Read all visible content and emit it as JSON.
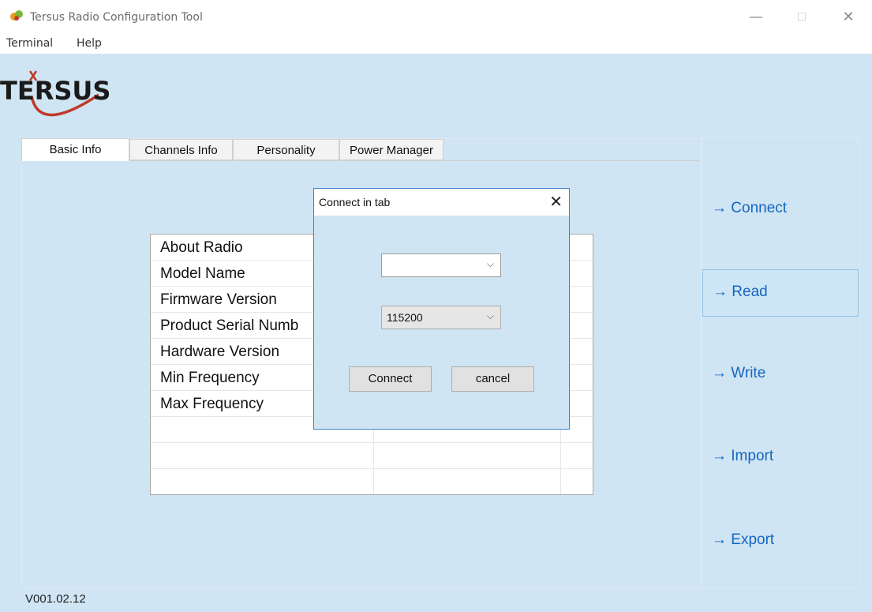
{
  "window": {
    "title": "Tersus Radio Configuration Tool",
    "controls": [
      "—",
      "☐",
      "✕"
    ]
  },
  "menu": [
    "Terminal",
    "Help"
  ],
  "logo": {
    "text": "TERSUS"
  },
  "tabs": [
    {
      "label": "Basic Info",
      "active": true
    },
    {
      "label": "Channels Info",
      "active": false
    },
    {
      "label": "Personality",
      "active": false
    },
    {
      "label": "Power Manager",
      "active": false
    }
  ],
  "grid": {
    "rows": [
      "About Radio",
      "Model Name",
      "Firmware Version",
      "Product Serial Numb",
      "Hardware Version",
      "Min Frequency",
      "Max Frequency",
      "",
      "",
      ""
    ]
  },
  "side_buttons": [
    "→ Connect",
    "→ Read",
    "→ Write",
    "→ Import",
    "→ Export"
  ],
  "version": "V001.02.12",
  "dialog": {
    "title": "Connect in tab",
    "close": "✕",
    "port_value": "",
    "baud_value": "115200",
    "chevron": "⌵",
    "connect_label": "Connect",
    "cancel_label": "cancel"
  },
  "colors": {
    "accent": "#1565c0",
    "background": "#cfe5f3",
    "dialog_border": "#3d7fc4"
  }
}
